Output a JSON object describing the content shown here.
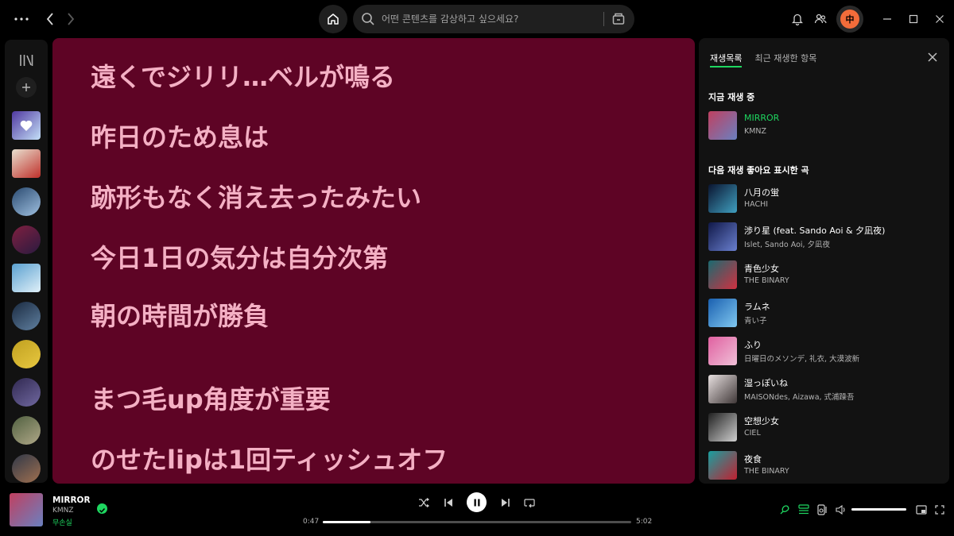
{
  "search": {
    "placeholder": "어떤 콘텐츠를 감상하고 싶으세요?"
  },
  "user": {
    "avatar_initial": "中"
  },
  "colors": {
    "accent": "#1ed760",
    "lyrics_bg": "#5e0425",
    "lyrics_text": "#f4b0c4",
    "avatar": "#f26c3a"
  },
  "library": {
    "icons": [
      "library-icon",
      "plus-icon"
    ],
    "items": [
      {
        "name": "liked-songs",
        "style": "sq",
        "c1": "#5038a0",
        "c2": "#c4e0f8"
      },
      {
        "name": "playlist-1",
        "style": "sq",
        "c1": "#e8e0d0",
        "c2": "#c0302a"
      },
      {
        "name": "playlist-2",
        "style": "round",
        "c1": "#2a4a70",
        "c2": "#9fc0e0"
      },
      {
        "name": "artist-1",
        "style": "round",
        "c1": "#802040",
        "c2": "#2a1a40"
      },
      {
        "name": "playlist-3",
        "style": "sq",
        "c1": "#5aa0d0",
        "c2": "#e0f0f8"
      },
      {
        "name": "artist-2",
        "style": "round",
        "c1": "#1a2a40",
        "c2": "#6080a0"
      },
      {
        "name": "artist-3",
        "style": "round",
        "c1": "#c0a020",
        "c2": "#e8c840"
      },
      {
        "name": "artist-4",
        "style": "round",
        "c1": "#302850",
        "c2": "#7068a0"
      },
      {
        "name": "artist-5",
        "style": "round",
        "c1": "#506040",
        "c2": "#b0a888"
      },
      {
        "name": "artist-6",
        "style": "round",
        "c1": "#303848",
        "c2": "#a07050"
      }
    ]
  },
  "lyrics": [
    "遠くでジリリ…ベルが鳴る",
    "昨日のため息は",
    "跡形もなく消え去ったみたい",
    "今日1日の気分は自分次第",
    "朝の時間が勝負",
    "",
    "まつ毛up角度が重要",
    "のせたlipは1回ティッシュオフ"
  ],
  "queue": {
    "tabs": [
      "재생목록",
      "최근 재생한 항목"
    ],
    "now_playing_heading": "지금 재생 중",
    "next_heading": "다음 재생 좋아요 표시한 곡",
    "now_playing": {
      "title": "MIRROR",
      "artist": "KMNZ",
      "c1": "#c04060",
      "c2": "#6a80c0"
    },
    "next": [
      {
        "title": "八月の蛍",
        "artist": "HACHI",
        "c1": "#0a1430",
        "c2": "#40a0c0"
      },
      {
        "title": "渉り星 (feat. Sando Aoi & 夕凪夜)",
        "artist": "Islet, Sando Aoi, 夕凪夜",
        "c1": "#101848",
        "c2": "#6a80d0"
      },
      {
        "title": "青色少女",
        "artist": "THE BINARY",
        "c1": "#1a6a70",
        "c2": "#d03040"
      },
      {
        "title": "ラムネ",
        "artist": "青い子",
        "c1": "#1a60b0",
        "c2": "#80c8f0"
      },
      {
        "title": "ふり",
        "artist": "日曜日のメソンデ, 礼衣, 大漠波新",
        "c1": "#e060a0",
        "c2": "#f0c0d8"
      },
      {
        "title": "湿っぽいね",
        "artist": "MAISONdes, Aizawa, 式浦躁吾",
        "c1": "#e8e0e0",
        "c2": "#403838"
      },
      {
        "title": "空想少女",
        "artist": "CIEL",
        "c1": "#202020",
        "c2": "#d0d0d0"
      },
      {
        "title": "夜食",
        "artist": "THE BINARY",
        "c1": "#18a0a0",
        "c2": "#c02030"
      }
    ]
  },
  "player": {
    "title": "MIRROR",
    "artist": "KMNZ",
    "badge": "무손실",
    "elapsed": "0:47",
    "duration": "5:02",
    "progress": 0.155,
    "volume": 1.0
  }
}
